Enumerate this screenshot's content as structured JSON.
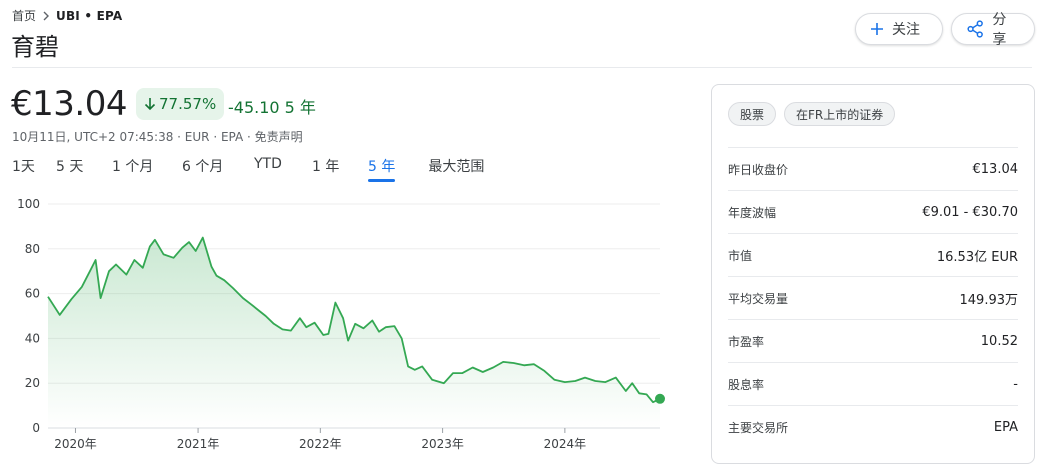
{
  "breadcrumb": {
    "home": "首页",
    "ticker": "UBI • EPA"
  },
  "title": "育碧",
  "buttons": {
    "follow": "关注",
    "share": "分享"
  },
  "quote": {
    "price": "€13.04",
    "change_pct": "77.57%",
    "change_abs": "-45.10 5 年",
    "info": "10月11日, UTC+2 07:45:38 · EUR · EPA · 免责声明",
    "color_down_in_green": "#137333"
  },
  "ranges": [
    {
      "label": "1天",
      "active": false
    },
    {
      "label": "5 天",
      "active": false
    },
    {
      "label": "1 个月",
      "active": false
    },
    {
      "label": "6 个月",
      "active": false
    },
    {
      "label": "YTD",
      "active": false
    },
    {
      "label": "1 年",
      "active": false
    },
    {
      "label": "5 年",
      "active": true
    },
    {
      "label": "最大范围",
      "active": false
    }
  ],
  "chart_data": {
    "type": "area",
    "color": "#34a853",
    "ylim": [
      0,
      100
    ],
    "yticks": [
      0,
      20,
      40,
      60,
      80,
      100
    ],
    "xticks": [
      "2020年",
      "2021年",
      "2022年",
      "2023年",
      "2024年"
    ],
    "xlim": [
      "2019-10-11",
      "2024-10-11"
    ],
    "x": [
      "2019-10-11",
      "2019-11-15",
      "2019-12-20",
      "2020-01-20",
      "2020-02-15",
      "2020-03-01",
      "2020-03-16",
      "2020-04-10",
      "2020-05-01",
      "2020-06-01",
      "2020-06-25",
      "2020-07-20",
      "2020-08-10",
      "2020-08-25",
      "2020-09-20",
      "2020-10-20",
      "2020-11-15",
      "2020-12-05",
      "2020-12-25",
      "2021-01-15",
      "2021-02-10",
      "2021-02-25",
      "2021-03-20",
      "2021-04-15",
      "2021-05-15",
      "2021-06-10",
      "2021-07-05",
      "2021-07-22",
      "2021-08-15",
      "2021-09-10",
      "2021-10-05",
      "2021-11-01",
      "2021-11-20",
      "2021-12-15",
      "2022-01-10",
      "2022-01-25",
      "2022-02-15",
      "2022-03-10",
      "2022-03-25",
      "2022-04-15",
      "2022-05-10",
      "2022-06-05",
      "2022-06-25",
      "2022-07-15",
      "2022-08-10",
      "2022-09-01",
      "2022-09-20",
      "2022-10-10",
      "2022-11-01",
      "2022-12-01",
      "2023-01-05",
      "2023-02-01",
      "2023-03-01",
      "2023-04-01",
      "2023-05-01",
      "2023-06-01",
      "2023-07-01",
      "2023-08-01",
      "2023-09-01",
      "2023-10-01",
      "2023-11-01",
      "2023-12-01",
      "2024-01-01",
      "2024-02-01",
      "2024-03-01",
      "2024-04-01",
      "2024-05-01",
      "2024-06-01",
      "2024-07-01",
      "2024-07-20",
      "2024-08-10",
      "2024-09-01",
      "2024-09-20",
      "2024-10-11"
    ],
    "values": [
      58.6,
      50.5,
      57.5,
      63.0,
      70.5,
      75.0,
      58.0,
      70.0,
      73.0,
      68.5,
      75.0,
      71.5,
      81.0,
      84.0,
      77.5,
      76.0,
      80.5,
      83.0,
      79.0,
      85.0,
      72.0,
      68.0,
      66.0,
      62.5,
      58.0,
      55.0,
      52.0,
      50.0,
      46.5,
      44.0,
      43.5,
      49.0,
      45.0,
      47.0,
      41.5,
      42.0,
      56.0,
      49.0,
      39.0,
      46.5,
      44.5,
      48.0,
      43.0,
      45.0,
      45.5,
      40.0,
      27.5,
      26.0,
      27.5,
      21.5,
      20.0,
      24.5,
      24.5,
      27.0,
      25.0,
      27.0,
      29.5,
      29.0,
      28.0,
      28.5,
      25.5,
      21.5,
      20.5,
      21.0,
      22.5,
      21.0,
      20.5,
      22.5,
      16.5,
      20.0,
      15.5,
      15.0,
      11.5,
      13.04
    ]
  },
  "stats": {
    "chips": [
      "股票",
      "在FR上市的证券"
    ],
    "rows": [
      {
        "label": "昨日收盘价",
        "value": "€13.04"
      },
      {
        "label": "年度波幅",
        "value": "€9.01 - €30.70"
      },
      {
        "label": "市值",
        "value": "16.53亿 EUR"
      },
      {
        "label": "平均交易量",
        "value": "149.93万"
      },
      {
        "label": "市盈率",
        "value": "10.52"
      },
      {
        "label": "股息率",
        "value": "-"
      },
      {
        "label": "主要交易所",
        "value": "EPA"
      }
    ]
  }
}
